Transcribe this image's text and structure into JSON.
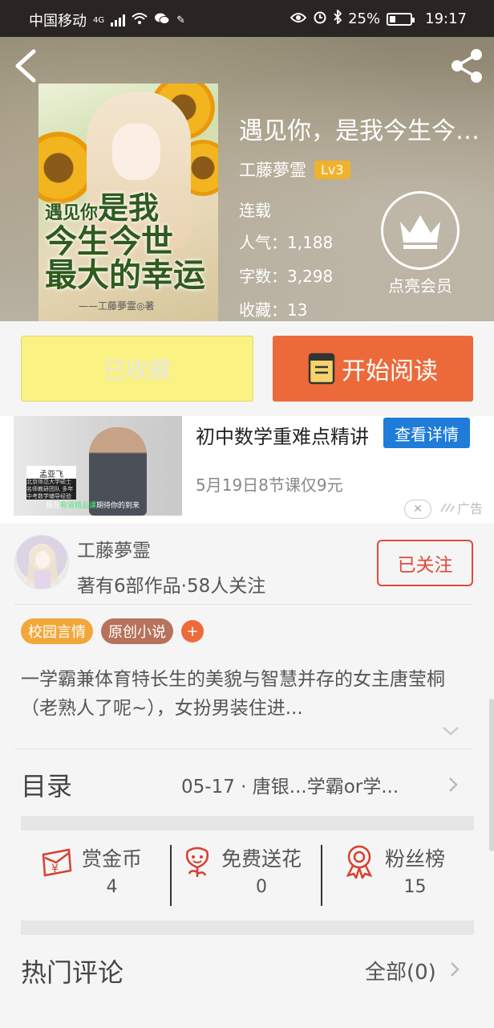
{
  "status_bar": {
    "carrier": "中国移动",
    "network": "4G",
    "battery_percent": "25%",
    "time": "19:17"
  },
  "header": {
    "back_icon": "back-arrow-icon",
    "share_icon": "share-icon"
  },
  "book": {
    "title": "遇见你，是我今生今世最大的幸运",
    "cover_text": {
      "line1_small": "遇见你",
      "line1": "是我",
      "line2": "今生今世",
      "line3": "最大的幸运",
      "author": "——工藤夢霊◎著"
    },
    "author": "工藤夢霊",
    "level": "Lv3",
    "status": "连载",
    "popularity_label": "人气：",
    "popularity": "1,188",
    "word_count_label": "字数：",
    "word_count": "3,298",
    "favorites_label": "收藏：",
    "favorites": "13",
    "vip_label": "点亮会员"
  },
  "actions": {
    "favorited_label": "已收藏",
    "read_label": "开始阅读"
  },
  "ad": {
    "title": "初中数学重难点精讲",
    "detail_button": "查看详情",
    "subtitle": "5月19日8节课仅9元",
    "teacher_name": "孟亚飞",
    "teacher_desc": "北京师范大学硕士 名师教研团队 多年中考数学辅导经验",
    "caption_pre": "我在",
    "caption_highlight": "有道精品课",
    "caption_post": "期待你的到来",
    "ad_label": "广告"
  },
  "author_card": {
    "name": "工藤夢霊",
    "stats": "著有6部作品·58人关注",
    "follow_label": "已关注"
  },
  "tags": [
    {
      "label": "校园言情",
      "color": "#f2a73b"
    },
    {
      "label": "原创小说",
      "color": "#b7725c"
    }
  ],
  "tag_add": "+",
  "description": "一学霸兼体育特长生的美貌与智慧并存的女主唐莹桐（老熟人了呢~），女扮男装住进...",
  "toc": {
    "label": "目录",
    "latest": "05-17 · 唐银...学霸or学..."
  },
  "stats": [
    {
      "label": "赏金币",
      "value": "4",
      "icon": "coin-envelope-icon"
    },
    {
      "label": "免费送花",
      "value": "0",
      "icon": "flower-icon"
    },
    {
      "label": "粉丝榜",
      "value": "15",
      "icon": "medal-icon"
    }
  ],
  "comments": {
    "label": "热门评论",
    "all_label": "全部(0)"
  },
  "colors": {
    "accent_orange": "#ec6a3a",
    "favorite_yellow": "#fbf284",
    "follow_red": "#e24a3a",
    "ad_blue": "#1f7cd9"
  }
}
